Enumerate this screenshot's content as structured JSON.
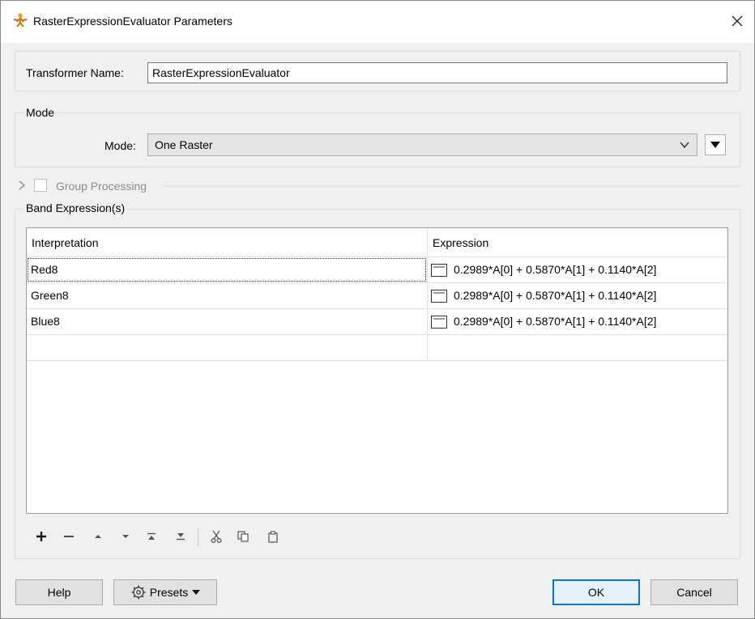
{
  "window": {
    "title": "RasterExpressionEvaluator Parameters"
  },
  "transformer_name": {
    "label": "Transformer Name:",
    "value": "RasterExpressionEvaluator"
  },
  "mode_group": {
    "legend": "Mode",
    "label": "Mode:",
    "value": "One Raster"
  },
  "group_processing": {
    "label": "Group Processing",
    "checked": false,
    "enabled": false
  },
  "band_expressions": {
    "legend": "Band Expression(s)",
    "columns": [
      "Interpretation",
      "Expression"
    ],
    "rows": [
      {
        "interpretation": "Red8",
        "expression": "0.2989*A[0] + 0.5870*A[1] + 0.1140*A[2]"
      },
      {
        "interpretation": "Green8",
        "expression": "0.2989*A[0] + 0.5870*A[1] + 0.1140*A[2]"
      },
      {
        "interpretation": "Blue8",
        "expression": "0.2989*A[0] + 0.5870*A[1] + 0.1140*A[2]"
      }
    ],
    "toolbar": [
      "add-icon",
      "remove-icon",
      "move-up-icon",
      "move-down-icon",
      "move-to-top-icon",
      "move-to-bottom-icon",
      "cut-icon",
      "copy-icon",
      "paste-icon"
    ]
  },
  "footer": {
    "help": "Help",
    "presets": "Presets",
    "ok": "OK",
    "cancel": "Cancel"
  },
  "colors": {
    "accent": "#0078d7",
    "dialog_bg": "#f0f0f0"
  }
}
